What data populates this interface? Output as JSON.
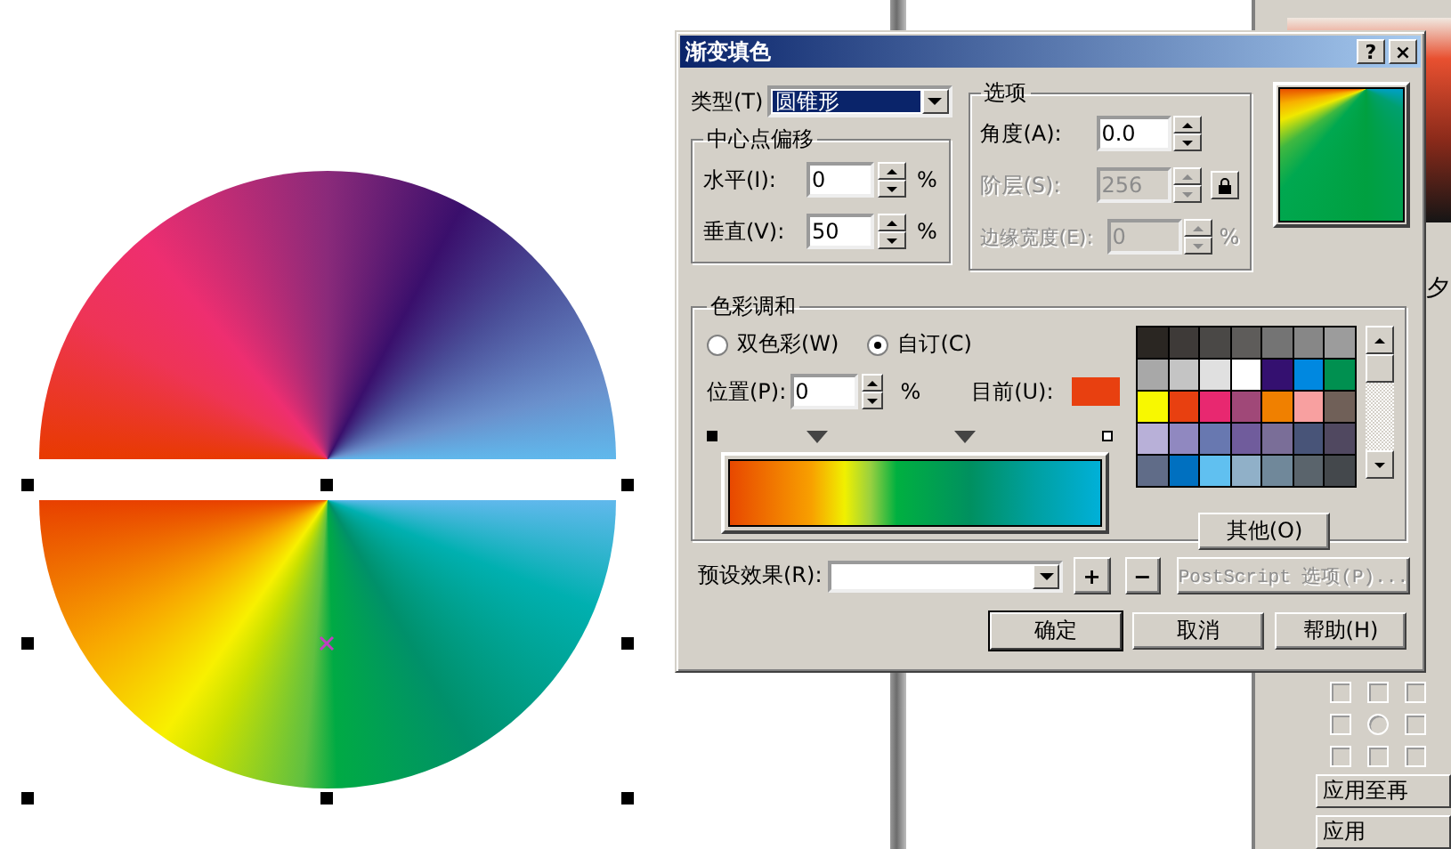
{
  "dialog": {
    "title": "渐变填色",
    "title_buttons": [
      "?",
      "×"
    ]
  },
  "type": {
    "label": "类型(T)",
    "value": "圆锥形"
  },
  "center_offset": {
    "title": "中心点偏移",
    "fields": [
      {
        "label": "水平(I):",
        "value": "0",
        "unit": "%"
      },
      {
        "label": "垂直(V):",
        "value": "50",
        "unit": "%"
      }
    ]
  },
  "options": {
    "title": "选项",
    "fields": [
      {
        "label": "角度(A):",
        "value": "0.0",
        "disabled": false,
        "kind": "spin"
      },
      {
        "label": "阶层(S):",
        "value": "256",
        "disabled": true,
        "kind": "spin_lock"
      },
      {
        "label": "边缘宽度(E):",
        "value": "0",
        "unit": "%",
        "disabled": true,
        "kind": "spin"
      }
    ]
  },
  "color_blend": {
    "title": "色彩调和",
    "modes": [
      {
        "label": "双色彩(W)",
        "selected": false
      },
      {
        "label": "自订(C)",
        "selected": true
      }
    ],
    "position": {
      "label": "位置(P):",
      "value": "0",
      "unit": "%"
    },
    "current": {
      "label": "目前(U):",
      "color": "#e84010"
    },
    "stops": [
      {
        "kind": "end",
        "selected": true
      },
      {
        "kind": "mid",
        "selected": false
      },
      {
        "kind": "mid",
        "selected": false
      },
      {
        "kind": "end",
        "selected": false
      }
    ],
    "palette": [
      {
        "color": "#2a2622"
      },
      {
        "color": "#3e3a38"
      },
      {
        "color": "#4a4846"
      },
      {
        "color": "#5e5c5a"
      },
      {
        "color": "#747474"
      },
      {
        "color": "#878787"
      },
      {
        "color": "#9c9c9c"
      },
      {
        "color": "#a8a8a8"
      },
      {
        "color": "#c4c4c4"
      },
      {
        "color": "#e0e0e0"
      },
      {
        "color": "#ffffff"
      },
      {
        "color": "#341070"
      },
      {
        "color": "#0088e0"
      },
      {
        "color": "#009050"
      },
      {
        "color": "#f8f800"
      },
      {
        "color": "#e84010"
      },
      {
        "color": "#e82870"
      },
      {
        "color": "#a04878"
      },
      {
        "color": "#f08000"
      },
      {
        "color": "#f8a0a0"
      },
      {
        "color": "#706058"
      },
      {
        "color": "#b8b0d8"
      },
      {
        "color": "#9088c0"
      },
      {
        "color": "#6878b0"
      },
      {
        "color": "#705c9c"
      },
      {
        "color": "#7a6e98"
      },
      {
        "color": "#485478"
      },
      {
        "color": "#504860"
      },
      {
        "color": "#606c88"
      },
      {
        "color": "#0070c0"
      },
      {
        "color": "#60c0f0"
      },
      {
        "color": "#90b0c8"
      },
      {
        "color": "#70889a"
      },
      {
        "color": "#5a646c"
      },
      {
        "color": "#44484c"
      }
    ],
    "other_button": "其他(O)"
  },
  "preset": {
    "label": "预设效果(R):",
    "add": "+",
    "remove": "−",
    "postscript": {
      "label": "PostScript 选项(P)...",
      "disabled": true
    }
  },
  "buttons": [
    {
      "label": "确定",
      "default": true
    },
    {
      "label": "取消",
      "default": false
    },
    {
      "label": "帮助(H)",
      "default": false
    }
  ],
  "docker": {
    "partial_label": "夕",
    "buttons": [
      "应用至再",
      "应用"
    ]
  }
}
